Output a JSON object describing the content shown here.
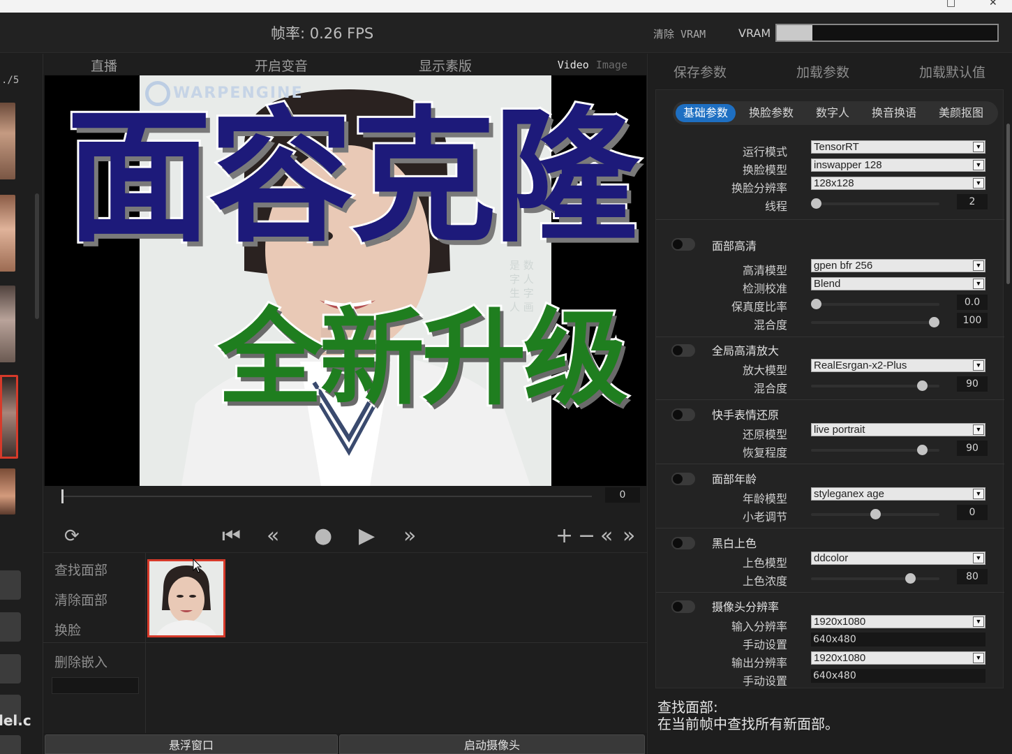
{
  "top": {
    "fps": "帧率: 0.26 FPS",
    "clear_vram": "清除 VRAM",
    "vram_label": "VRAM",
    "vram_usage": 0.16
  },
  "left": {
    "counter": "./5",
    "model_button_label": "lel.c"
  },
  "viewer": {
    "tabs": [
      "直播",
      "开启变音",
      "显示素版"
    ],
    "mode_video": "Video",
    "mode_image": "Image",
    "watermark": "WARPENGINE",
    "side_watermark": "是 数 字 人 生 字 人 画",
    "overlay_title": "面容克隆",
    "overlay_subtitle": "全新升级",
    "frame_number": "0"
  },
  "face_panel": {
    "find_faces": "查找面部",
    "clear_faces": "清除面部",
    "swap_faces": "换脸",
    "delete_embedding": "删除嵌入"
  },
  "bottom": {
    "float_window": "悬浮窗口",
    "start_camera": "启动摄像头"
  },
  "params": {
    "actions": [
      "保存参数",
      "加载参数",
      "加载默认值"
    ],
    "tabs": [
      "基础参数",
      "换脸参数",
      "数字人",
      "换音换语",
      "美颜抠图"
    ],
    "active_tab": 0,
    "basic": {
      "run_mode_label": "运行模式",
      "run_mode": "TensorRT",
      "swap_model_label": "换脸模型",
      "swap_model": "inswapper 128",
      "swap_res_label": "换脸分辨率",
      "swap_res": "128x128",
      "threads_label": "线程",
      "threads": "2",
      "threads_frac": 0.0
    },
    "face_restore": {
      "title": "面部高清",
      "model_label": "高清模型",
      "model": "gpen bfr 256",
      "detect_label": "检测校准",
      "detect": "Blend",
      "fidelity_label": "保真度比率",
      "fidelity": "0.0",
      "fidelity_frac": 0.0,
      "blend_label": "混合度",
      "blend": "100",
      "blend_frac": 1.0
    },
    "upscale": {
      "title": "全局高清放大",
      "model_label": "放大模型",
      "model": "RealEsrgan-x2-Plus",
      "blend_label": "混合度",
      "blend": "90",
      "blend_frac": 0.9
    },
    "expression": {
      "title": "快手表情还原",
      "model_label": "还原模型",
      "model": "live portrait",
      "degree_label": "恢复程度",
      "degree": "90",
      "degree_frac": 0.9
    },
    "age": {
      "title": "面部年龄",
      "model_label": "年龄模型",
      "model": "styleganex age",
      "adjust_label": "小老调节",
      "adjust": "0",
      "adjust_frac": 0.5
    },
    "colorize": {
      "title": "黑白上色",
      "model_label": "上色模型",
      "model": "ddcolor",
      "strength_label": "上色浓度",
      "strength": "80",
      "strength_frac": 0.8
    },
    "camera": {
      "title": "摄像头分辨率",
      "input_label": "输入分辨率",
      "input": "1920x1080",
      "manual1_label": "手动设置",
      "manual1": "640x480",
      "output_label": "输出分辨率",
      "output": "1920x1080",
      "manual2_label": "手动设置",
      "manual2": "640x480"
    }
  },
  "help": {
    "title": "查找面部:",
    "text": "在当前帧中查找所有新面部。"
  }
}
